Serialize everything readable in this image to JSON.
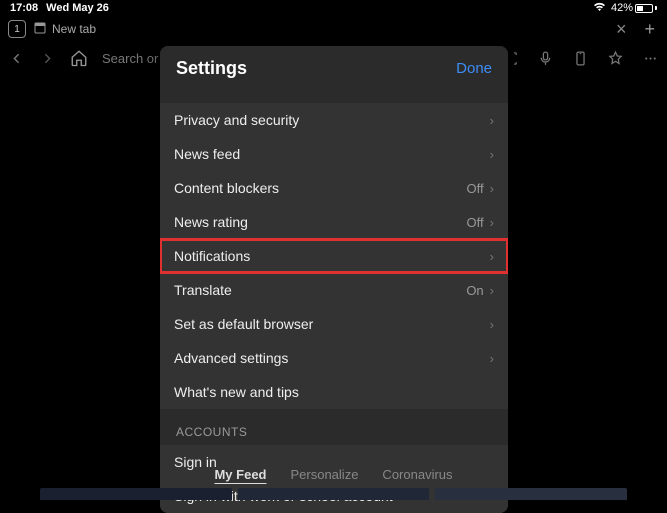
{
  "status": {
    "time": "17:08",
    "date": "Wed May 26",
    "battery": "42%"
  },
  "tabs": {
    "count": "1",
    "new_tab_label": "New tab"
  },
  "toolbar": {
    "search_placeholder": "Search or ent"
  },
  "settings": {
    "title": "Settings",
    "done": "Done",
    "rows": [
      {
        "label": "Privacy and security",
        "value": "",
        "hl": false
      },
      {
        "label": "News feed",
        "value": "",
        "hl": false
      },
      {
        "label": "Content blockers",
        "value": "Off",
        "hl": false
      },
      {
        "label": "News rating",
        "value": "Off",
        "hl": false
      },
      {
        "label": "Notifications",
        "value": "",
        "hl": true
      },
      {
        "label": "Translate",
        "value": "On",
        "hl": false
      },
      {
        "label": "Set as default browser",
        "value": "",
        "hl": false
      },
      {
        "label": "Advanced settings",
        "value": "",
        "hl": false
      },
      {
        "label": "What's new and tips",
        "value": "",
        "hl": false,
        "noChevron": true
      }
    ],
    "accounts_header": "ACCOUNTS",
    "accounts": [
      {
        "label": "Sign in"
      },
      {
        "label": "Sign in with work or school account"
      }
    ]
  },
  "feed_tabs": {
    "myfeed": "My Feed",
    "personalize": "Personalize",
    "coronavirus": "Coronavirus"
  }
}
